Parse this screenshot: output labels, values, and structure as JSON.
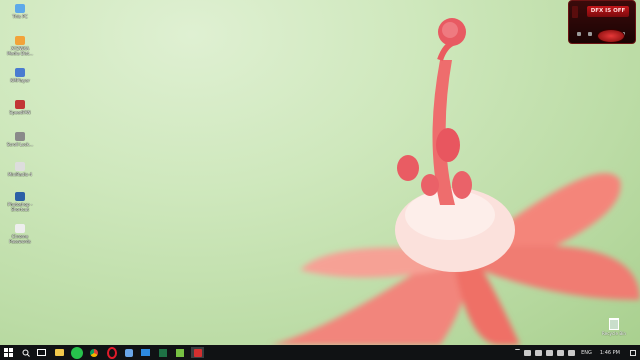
{
  "desktop": {
    "icons": [
      {
        "label": "This PC",
        "icon": "computer-icon",
        "color": "#5da9e9"
      },
      {
        "label": "XYZWXA\nMedia Dist...",
        "icon": "app-icon",
        "color": "#f2a33a"
      },
      {
        "label": "KMPlayer",
        "icon": "media-player-icon",
        "color": "#4a7bd0"
      },
      {
        "label": "SpeedFAN",
        "icon": "fan-icon",
        "color": "#c23636"
      },
      {
        "label": "Scroll Lock...",
        "icon": "app-icon",
        "color": "#8a8a8a"
      },
      {
        "label": "MiniRadio 4",
        "icon": "radio-icon",
        "color": "#dddddd"
      },
      {
        "label": "Photoshop -\nShortcut",
        "icon": "photoshop-icon",
        "color": "#2b5fa6"
      },
      {
        "label": "Chrome\nPasswords",
        "icon": "document-icon",
        "color": "#eeeeee"
      }
    ],
    "recycle_bin": {
      "label": "Recycle Bin",
      "icon": "recycle-bin-icon"
    }
  },
  "dfx_widget": {
    "status": "DFX IS OFF",
    "accent": "#c3161a"
  },
  "taskbar": {
    "apps": [
      {
        "icon": "search-icon",
        "color": "#ffffff"
      },
      {
        "icon": "task-view-icon",
        "color": "#ffffff"
      },
      {
        "icon": "file-explorer-icon",
        "color": "#f2c94c"
      },
      {
        "icon": "green-app-icon",
        "color": "#27c24c"
      },
      {
        "icon": "chrome-icon",
        "color": "#4caf50"
      },
      {
        "icon": "opera-icon",
        "color": "#e21b2a"
      },
      {
        "icon": "settings-icon",
        "color": "#6aa6e8"
      },
      {
        "icon": "mail-icon",
        "color": "#2d8ae0"
      },
      {
        "icon": "excel-icon",
        "color": "#1e7145"
      },
      {
        "icon": "camtasia-icon",
        "color": "#76c043"
      },
      {
        "icon": "recorder-icon",
        "color": "#d32f2f"
      }
    ],
    "language": "ENG",
    "time": "1:46 PM"
  }
}
